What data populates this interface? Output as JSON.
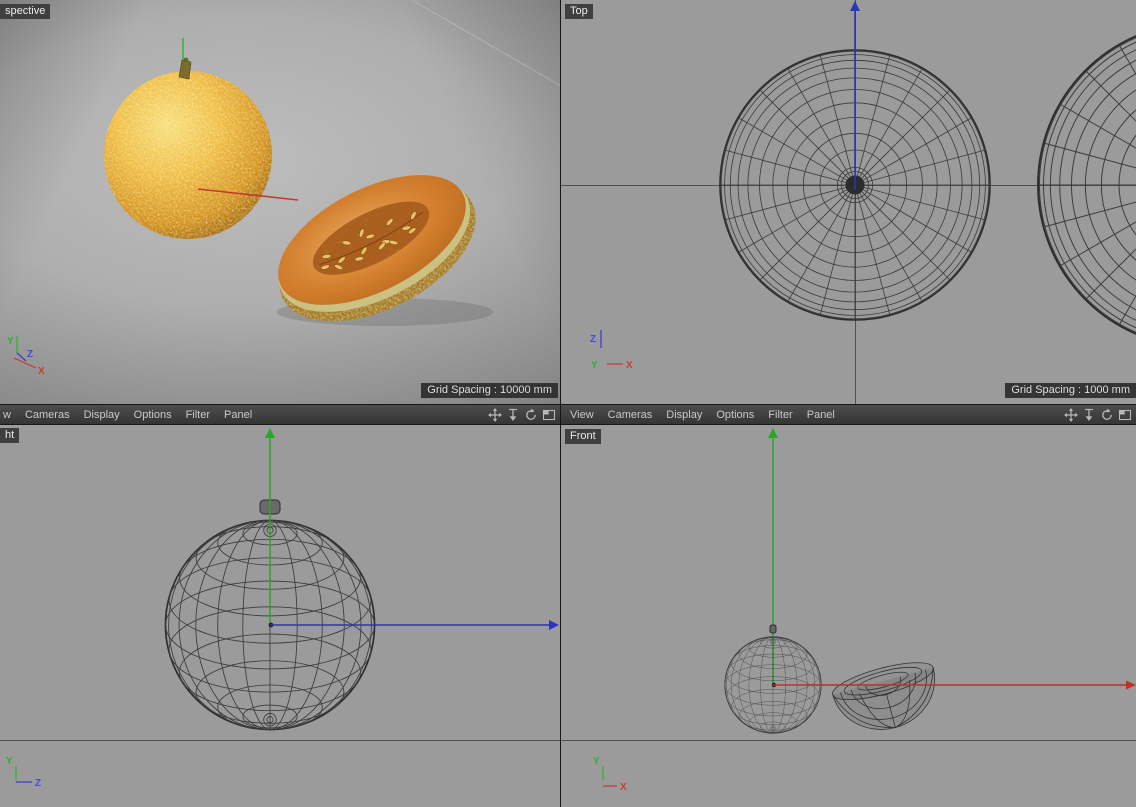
{
  "viewports": {
    "perspective": {
      "label": "spective",
      "grid_spacing": "Grid Spacing : 10000 mm",
      "gizmo": {
        "x": "X",
        "y": "Y",
        "z": "Z"
      }
    },
    "top": {
      "label": "Top",
      "grid_spacing": "Grid Spacing : 1000 mm",
      "gizmo": {
        "x": "X",
        "y": "Y",
        "z": "Z"
      }
    },
    "right": {
      "label": "ht",
      "gizmo": {
        "y": "Y",
        "z": "Z"
      }
    },
    "front": {
      "label": "Front",
      "gizmo": {
        "x": "X",
        "y": "Y"
      }
    }
  },
  "menus": {
    "left": [
      "w",
      "Cameras",
      "Display",
      "Options",
      "Filter",
      "Panel"
    ],
    "right": [
      "View",
      "Cameras",
      "Display",
      "Options",
      "Filter",
      "Panel"
    ]
  },
  "toolbar_icons": [
    "pan-icon",
    "zoom-icon",
    "rotate-icon",
    "toggle-view-icon"
  ],
  "colors": {
    "axis_x": "#c43a2e",
    "axis_y": "#2db22d",
    "axis_z": "#2a35c0",
    "viewport_bg": "#9b9b9b",
    "menu_bg": "#3d3d3d",
    "wireframe": "#3a3a3a"
  }
}
